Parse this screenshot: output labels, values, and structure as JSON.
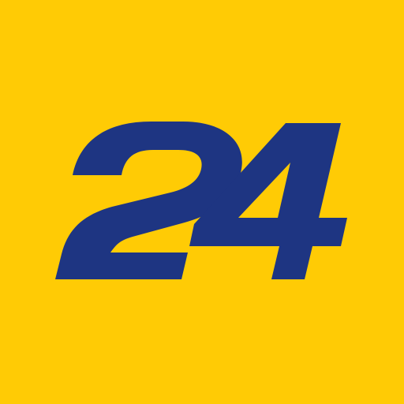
{
  "logo": {
    "text": "24",
    "colors": {
      "background": "#FFCB05",
      "glyph": "#1E3582"
    }
  }
}
